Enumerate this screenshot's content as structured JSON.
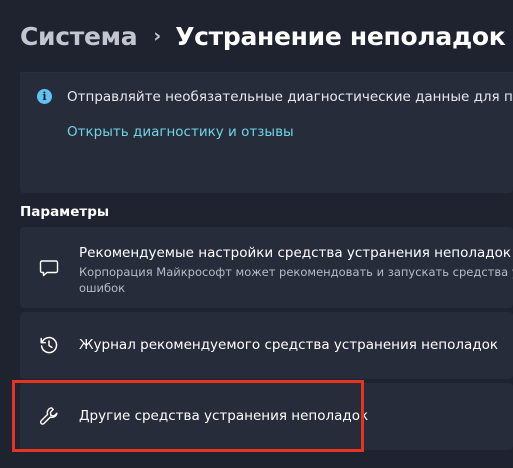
{
  "header": {
    "parent": "Система",
    "separator": "›",
    "current": "Устранение неполадок"
  },
  "info": {
    "icon": "info-icon",
    "text": "Отправляйте необязательные диагностические данные для получения",
    "link": "Открыть диагностику и отзывы"
  },
  "section": {
    "label": "Параметры"
  },
  "options": [
    {
      "icon": "chat-bubble-icon",
      "title": "Рекомендуемые настройки средства устранения неполадок",
      "desc_line1": "Корпорация Майкрософт может рекомендовать и запускать средства устране",
      "desc_line2": "ошибок"
    },
    {
      "icon": "history-icon",
      "title": "Журнал рекомендуемого средства устранения неполадок"
    },
    {
      "icon": "wrench-icon",
      "title": "Другие средства устранения неполадок"
    }
  ],
  "colors": {
    "background": "#1f2330",
    "card": "#272c3a",
    "link": "#6fd4e6",
    "info_icon": "#60c3f5",
    "highlight": "#e5341f"
  }
}
